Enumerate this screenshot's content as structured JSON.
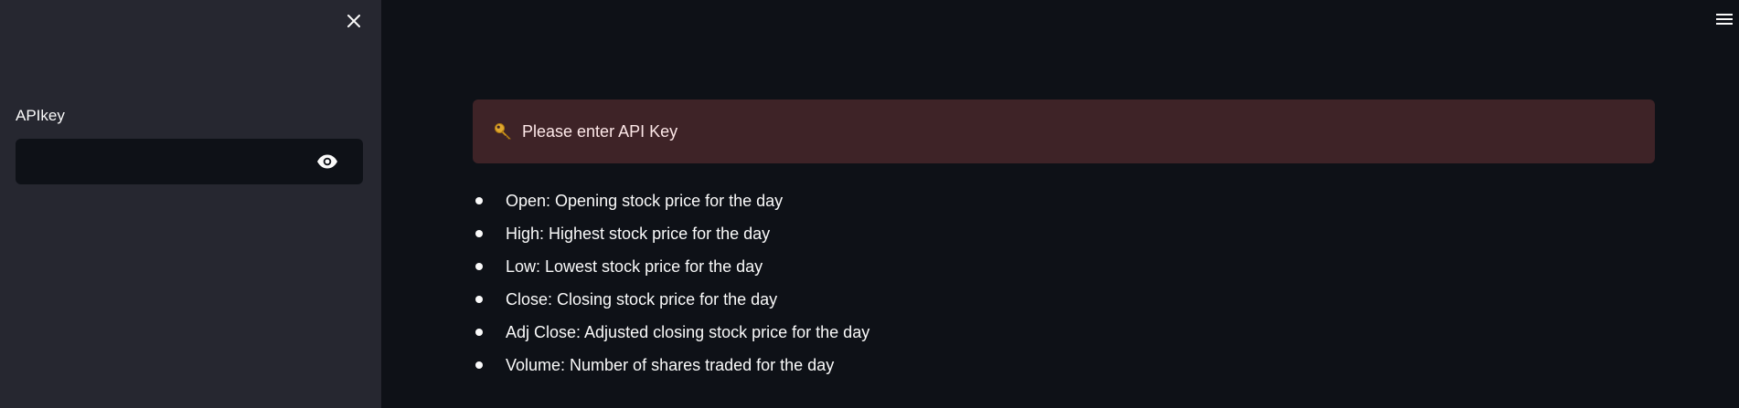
{
  "sidebar": {
    "close_icon": "close-icon",
    "apikey_label": "APIkey",
    "apikey_value": "",
    "apikey_placeholder": "",
    "reveal_icon": "eye-icon"
  },
  "header": {
    "menu_icon": "hamburger-menu-icon"
  },
  "alert": {
    "icon": "key-icon",
    "text": "Please enter API Key",
    "background": "#3e2327"
  },
  "definitions": [
    "Open: Opening stock price for the day",
    "High: Highest stock price for the day",
    "Low: Lowest stock price for the day",
    "Close: Closing stock price for the day",
    "Adj Close: Adjusted closing stock price for the day",
    "Volume: Number of shares traded for the day"
  ],
  "colors": {
    "app_background": "#0e1117",
    "sidebar_background": "#262730",
    "text": "#fafafa"
  }
}
